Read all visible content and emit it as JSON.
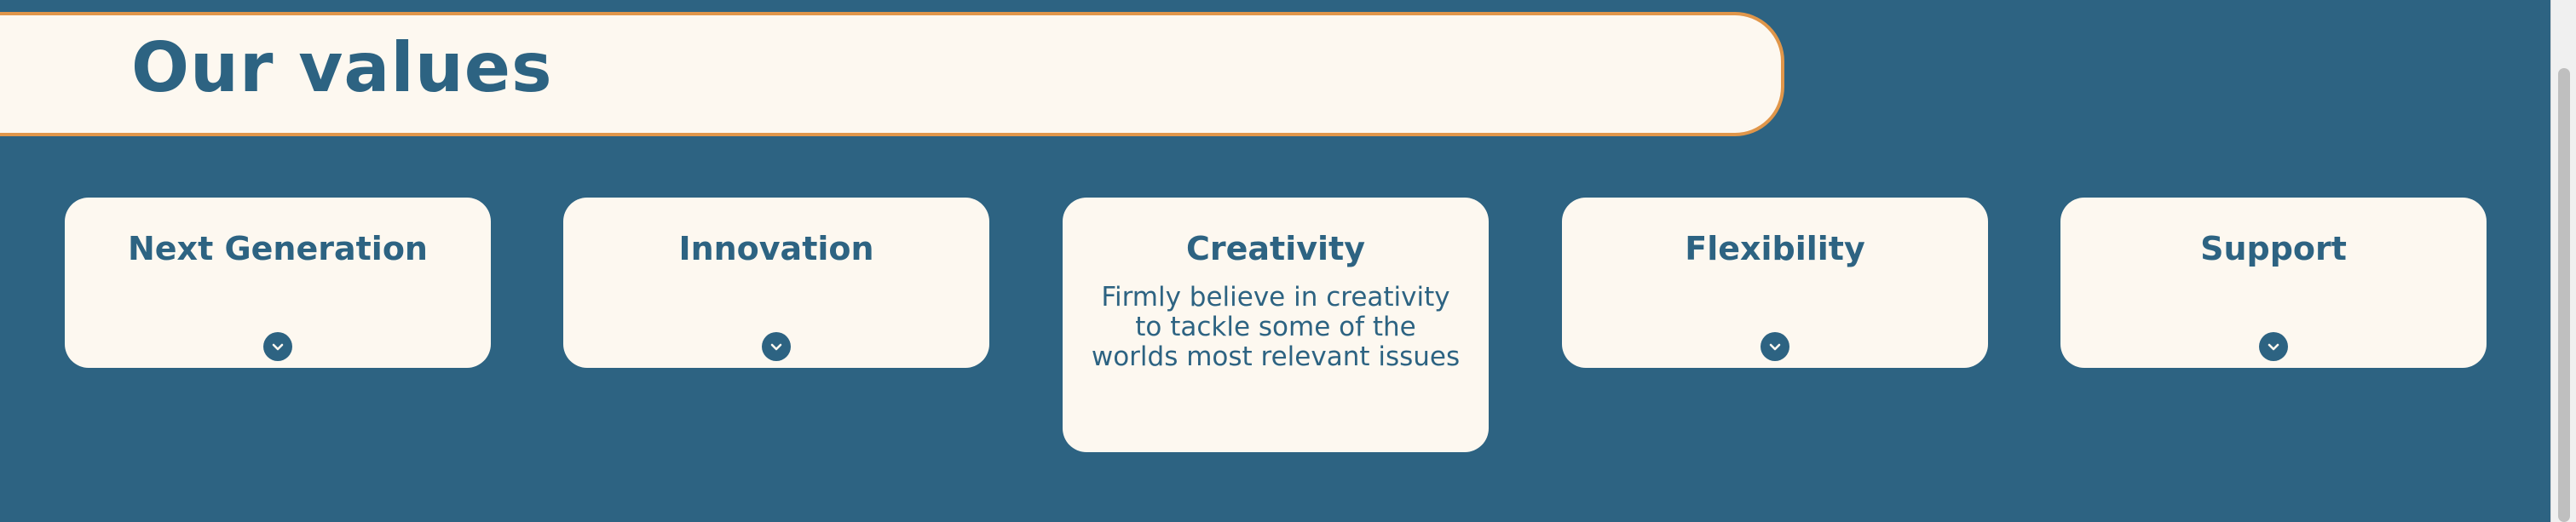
{
  "section": {
    "title": "Our values"
  },
  "values": [
    {
      "title": "Next Generation",
      "expanded": false,
      "toggle_icon": "chevron-down-icon"
    },
    {
      "title": "Innovation",
      "expanded": false,
      "toggle_icon": "chevron-down-icon"
    },
    {
      "title": "Creativity",
      "expanded": true,
      "description": "Firmly believe in creativity to tackle some of the worlds most relevant issues"
    },
    {
      "title": "Flexibility",
      "expanded": false,
      "toggle_icon": "chevron-down-icon"
    },
    {
      "title": "Support",
      "expanded": false,
      "toggle_icon": "chevron-down-icon"
    }
  ],
  "colors": {
    "background": "#2d6382",
    "card": "#fdf8f0",
    "banner_border": "#e0964a",
    "text": "#2d6382"
  }
}
